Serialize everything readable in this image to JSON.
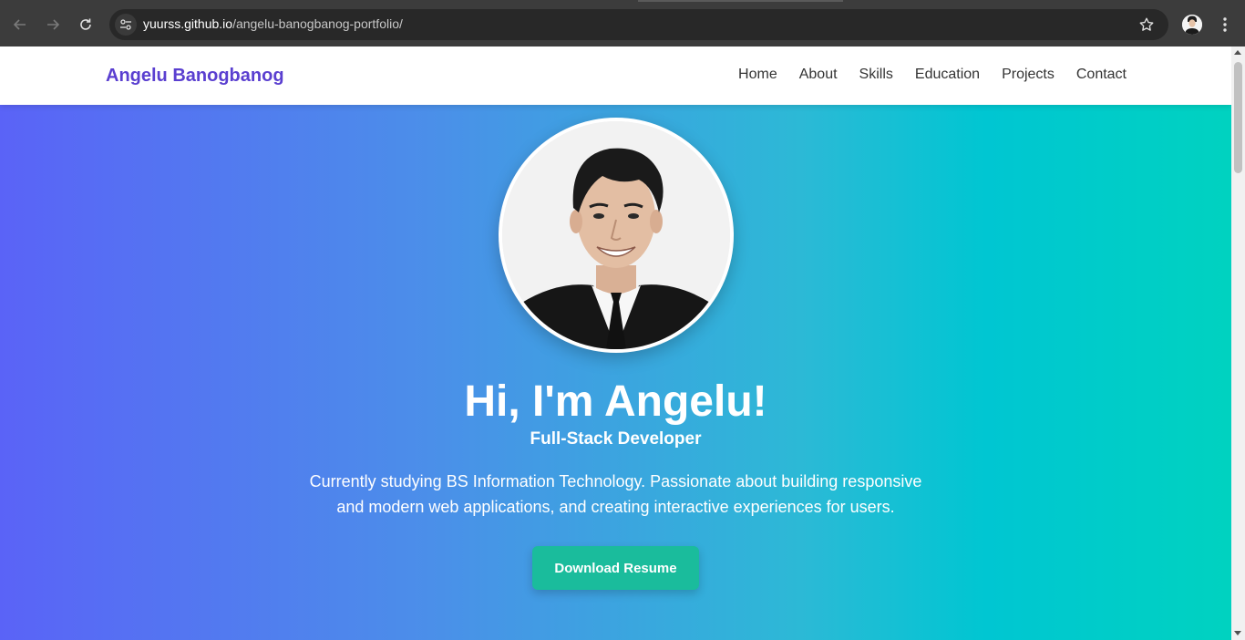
{
  "browser": {
    "url_host": "yuurss.github.io",
    "url_path": "/angelu-banogbanog-portfolio/",
    "back_icon": "arrow-left-icon",
    "forward_icon": "arrow-right-icon",
    "reload_icon": "reload-icon",
    "site_info_icon": "tune-icon",
    "bookmark_icon": "star-icon",
    "menu_icon": "more-vert-icon"
  },
  "header": {
    "brand": "Angelu Banogbanog",
    "nav": [
      "Home",
      "About",
      "Skills",
      "Education",
      "Projects",
      "Contact"
    ]
  },
  "hero": {
    "title": "Hi, I'm Angelu!",
    "subtitle": "Full-Stack Developer",
    "description": "Currently studying BS Information Technology. Passionate about building responsive and modern web applications, and creating interactive experiences for users.",
    "cta_label": "Download Resume",
    "colors": {
      "gradient_start": "#5a63f7",
      "gradient_end": "#00d2c0",
      "button": "#1abc9c",
      "brand": "#5a3fd0"
    }
  }
}
